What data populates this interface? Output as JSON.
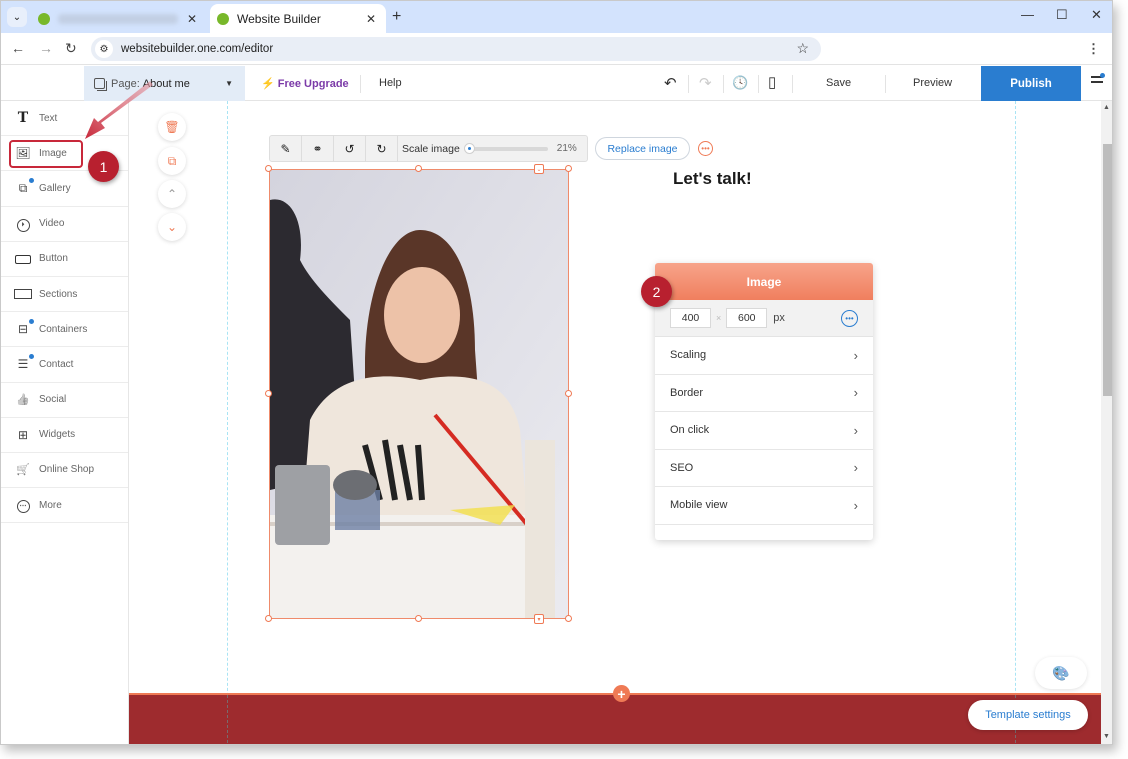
{
  "browser": {
    "tabs": [
      {
        "label": "",
        "blurred": true,
        "active": false
      },
      {
        "label": "Website Builder",
        "active": true
      }
    ],
    "close_glyph": "✕",
    "new_tab_glyph": "+",
    "window_controls": {
      "minimize": "—",
      "maximize": "☐",
      "close": "✕"
    },
    "url": "websitebuilder.one.com/editor",
    "nav": {
      "back": "←",
      "forward": "→",
      "reload": "↻"
    },
    "bookmark_glyph": "☆",
    "menu_glyph": "⋮"
  },
  "editor_bar": {
    "page_prefix": "Page:",
    "page_name": "About me",
    "upgrade_label": "Free Upgrade",
    "upgrade_glyph": "⚡",
    "help_label": "Help",
    "undo_glyph": "↶",
    "redo_glyph": "↷",
    "history_glyph": "🕓",
    "mobile_glyph": "▯",
    "save_label": "Save",
    "preview_label": "Preview",
    "publish_label": "Publish",
    "accent_color": "#2a7dd0"
  },
  "sidebar": {
    "items": [
      {
        "label": "Text",
        "icon": "T",
        "dot": false
      },
      {
        "label": "Image",
        "icon": "🖼",
        "dot": false
      },
      {
        "label": "Gallery",
        "icon": "⧉",
        "dot": true
      },
      {
        "label": "Video",
        "icon": "⏵",
        "dot": false
      },
      {
        "label": "Button",
        "icon": "▭",
        "dot": false
      },
      {
        "label": "Sections",
        "icon": "▭",
        "dot": false
      },
      {
        "label": "Containers",
        "icon": "⊟",
        "dot": true
      },
      {
        "label": "Contact",
        "icon": "☰",
        "dot": true
      },
      {
        "label": "Social",
        "icon": "👍",
        "dot": false
      },
      {
        "label": "Widgets",
        "icon": "⊞",
        "dot": false
      },
      {
        "label": "Online Shop",
        "icon": "🛒",
        "dot": false
      },
      {
        "label": "More",
        "icon": "⋯",
        "dot": false
      }
    ]
  },
  "annotations": {
    "step1": "1",
    "step2": "2",
    "color": "#b8202f"
  },
  "canvas": {
    "side_tools": [
      {
        "name": "delete",
        "glyph": "🗑"
      },
      {
        "name": "duplicate",
        "glyph": "⧉"
      },
      {
        "name": "move-up",
        "glyph": "⌃"
      },
      {
        "name": "move-down",
        "glyph": "⌄"
      }
    ],
    "image_toolbar": {
      "edit_glyph": "✎",
      "link_glyph": "⚭",
      "rotate_left_glyph": "↺",
      "rotate_right_glyph": "↻",
      "scale_label": "Scale image",
      "scale_value": "21%",
      "scale_fraction": 0.0
    },
    "replace_label": "Replace image",
    "more_glyph": "•••",
    "heading": "Let's talk!"
  },
  "image_panel": {
    "title": "Image",
    "width": "400",
    "height": "600",
    "unit": "px",
    "times_glyph": "×",
    "more_glyph": "•••",
    "rows": [
      {
        "label": "Scaling"
      },
      {
        "label": "Border"
      },
      {
        "label": "On click"
      },
      {
        "label": "SEO"
      },
      {
        "label": "Mobile view"
      }
    ],
    "chevron": "›",
    "header_color": "#f07f5e"
  },
  "footer": {
    "add_glyph": "+",
    "template_settings_label": "Template settings",
    "swatch_glyph": "🎨",
    "band_color": "#9e2b2e"
  }
}
